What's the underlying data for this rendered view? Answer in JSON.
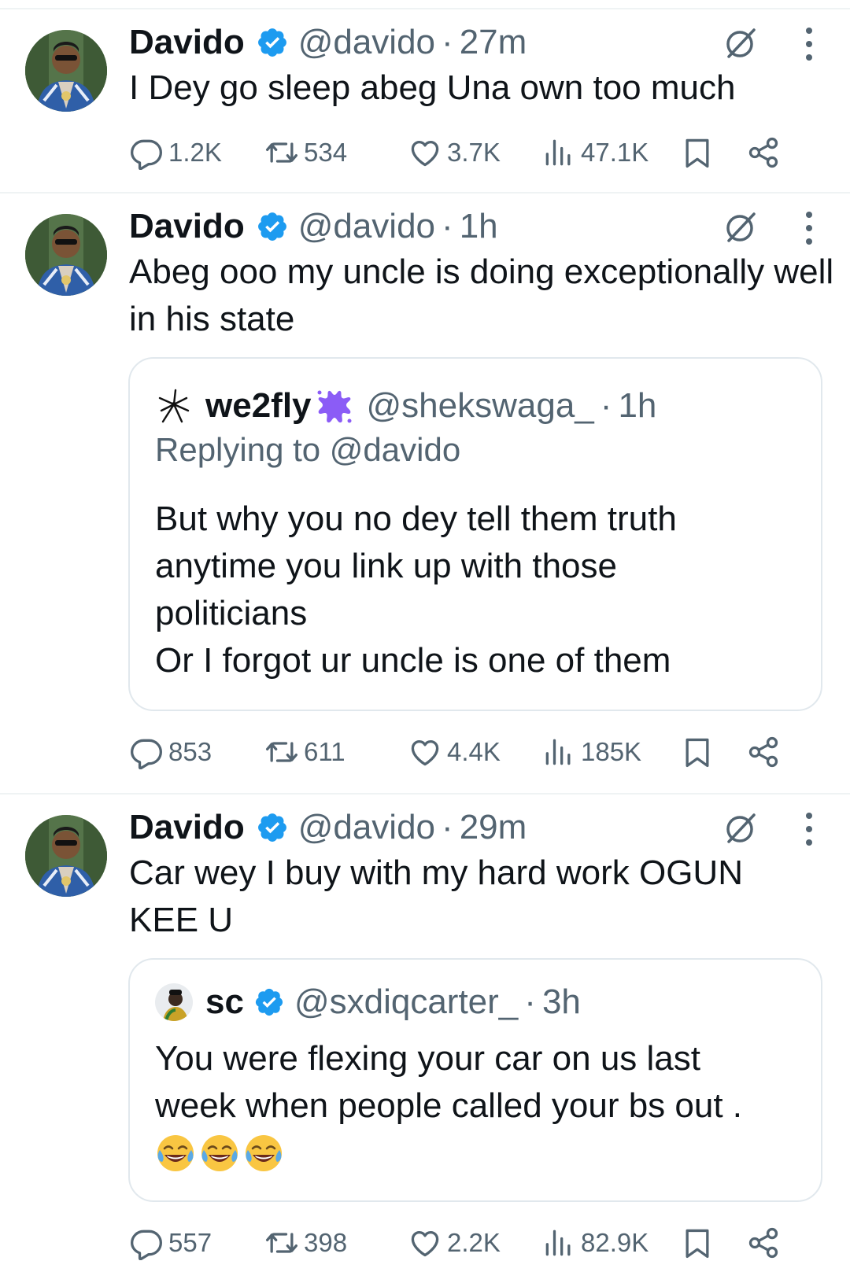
{
  "tweets": [
    {
      "name": "Davido",
      "handle": "@davido",
      "sep": "·",
      "time": "27m",
      "text": "I Dey go sleep abeg Una own too much",
      "stats": {
        "replies": "1.2K",
        "reposts": "534",
        "likes": "3.7K",
        "views": "47.1K"
      }
    },
    {
      "name": "Davido",
      "handle": "@davido",
      "sep": "·",
      "time": "1h",
      "text": "Abeg ooo my uncle  is doing  exceptionally well in his state",
      "quote": {
        "name": "we2fly",
        "handle": "@shekswaga_",
        "sep": "·",
        "time": "1h",
        "replying_prefix": "Replying to ",
        "replying_handle": "@davido",
        "text_lines": [
          "But why you no dey tell them truth",
          "anytime you link up with those",
          "politicians",
          "Or I forgot ur uncle is one of them"
        ]
      },
      "stats": {
        "replies": "853",
        "reposts": "611",
        "likes": "4.4K",
        "views": "185K"
      }
    },
    {
      "name": "Davido",
      "handle": "@davido",
      "sep": "·",
      "time": "29m",
      "text": "Car wey I buy with my hard work OGUN KEE U",
      "quote": {
        "name": "sc",
        "handle": "@sxdiqcarter_",
        "sep": "·",
        "time": "3h",
        "text_lines": [
          "You were flexing your car on us last",
          "week when people called your bs out ."
        ],
        "emojis": [
          "face-with-tears-of-joy",
          "face-with-tears-of-joy",
          "face-with-tears-of-joy"
        ]
      },
      "stats": {
        "replies": "557",
        "reposts": "398",
        "likes": "2.2K",
        "views": "82.9K"
      }
    }
  ],
  "icons": {
    "verified": "verified-badge-icon",
    "grok": "grok-icon",
    "more": "more-options-icon",
    "reply": "reply-icon",
    "repost": "repost-icon",
    "like": "like-icon",
    "views": "views-icon",
    "bookmark": "bookmark-icon",
    "share": "share-icon"
  },
  "colors": {
    "verified": "#1d9bf0",
    "text": "#0f1419",
    "muted": "#536471",
    "border": "#e1e8ed",
    "splat": "#8b5cf6"
  }
}
